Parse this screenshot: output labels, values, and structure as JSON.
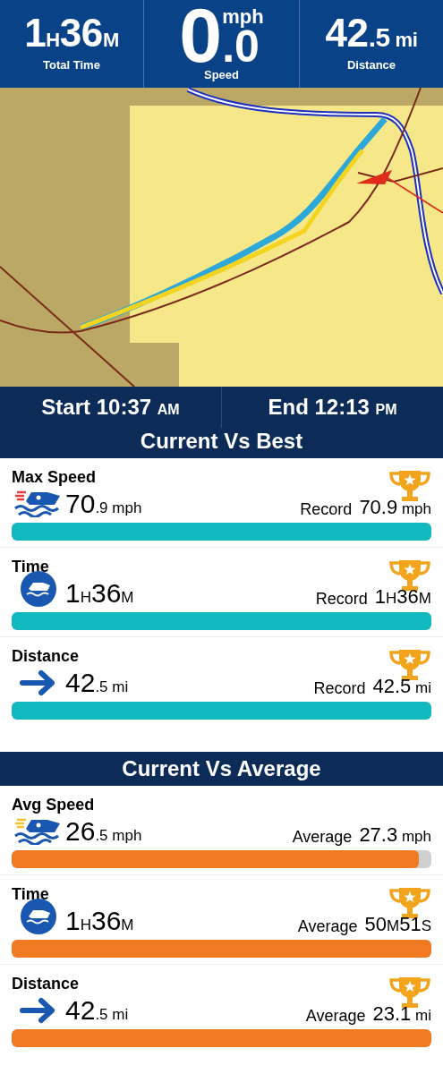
{
  "header_stats": [
    {
      "kind": "inline",
      "parts": [
        {
          "text": "1",
          "kind": "major"
        },
        {
          "text": "H",
          "kind": "minor"
        },
        {
          "text": "36",
          "kind": "major"
        },
        {
          "text": "M",
          "kind": "minor"
        }
      ],
      "label": "Total Time"
    },
    {
      "kind": "stacked",
      "whole": "0",
      "unit": "mph",
      "fraction": ".0",
      "label": "Speed"
    },
    {
      "kind": "inline",
      "parts": [
        {
          "text": "42",
          "kind": "major"
        },
        {
          "text": ".5",
          "kind": "mid"
        },
        {
          "text": " mi",
          "kind": "minor"
        }
      ],
      "label": "Distance"
    }
  ],
  "trip_times": [
    {
      "label": "Start",
      "time": "10:37",
      "period": "AM"
    },
    {
      "label": "End",
      "time": "12:13",
      "period": "PM"
    }
  ],
  "sections": [
    {
      "title": "Current Vs Best",
      "kind": "best",
      "rows": [
        {
          "label": "Max Speed",
          "kind": "speed",
          "value": [
            {
              "text": "70",
              "kind": "major"
            },
            {
              "text": ".9 mph",
              "kind": "minor"
            }
          ],
          "compare_label": "Record",
          "compare": [
            {
              "text": "70.9",
              "kind": "mid"
            },
            {
              "text": " mph",
              "kind": "minor"
            }
          ],
          "trophy": true,
          "level": 1
        },
        {
          "label": "Time",
          "kind": "time",
          "value": [
            {
              "text": "1",
              "kind": "major"
            },
            {
              "text": "H",
              "kind": "minor"
            },
            {
              "text": "36",
              "kind": "major"
            },
            {
              "text": "M",
              "kind": "minor"
            }
          ],
          "compare_label": "Record",
          "compare": [
            {
              "text": "1",
              "kind": "mid"
            },
            {
              "text": "H",
              "kind": "minor"
            },
            {
              "text": "36",
              "kind": "mid"
            },
            {
              "text": "M",
              "kind": "minor"
            }
          ],
          "trophy": true,
          "level": 1
        },
        {
          "label": "Distance",
          "kind": "distance",
          "value": [
            {
              "text": "42",
              "kind": "major"
            },
            {
              "text": ".5 mi",
              "kind": "minor"
            }
          ],
          "compare_label": "Record",
          "compare": [
            {
              "text": "42.5",
              "kind": "mid"
            },
            {
              "text": " mi",
              "kind": "minor"
            }
          ],
          "trophy": true,
          "level": 1
        }
      ]
    },
    {
      "title": "Current Vs Average",
      "kind": "average",
      "rows": [
        {
          "label": "Avg Speed",
          "kind": "speed",
          "value": [
            {
              "text": "26",
              "kind": "major"
            },
            {
              "text": ".5 mph",
              "kind": "minor"
            }
          ],
          "compare_label": "Average",
          "compare": [
            {
              "text": "27.3",
              "kind": "mid"
            },
            {
              "text": " mph",
              "kind": "minor"
            }
          ],
          "trophy": false,
          "level": 0.97
        },
        {
          "label": "Time",
          "kind": "time",
          "value": [
            {
              "text": "1",
              "kind": "major"
            },
            {
              "text": "H",
              "kind": "minor"
            },
            {
              "text": "36",
              "kind": "major"
            },
            {
              "text": "M",
              "kind": "minor"
            }
          ],
          "compare_label": "Average",
          "compare": [
            {
              "text": "50",
              "kind": "mid"
            },
            {
              "text": "M",
              "kind": "minor"
            },
            {
              "text": "51",
              "kind": "mid"
            },
            {
              "text": "S",
              "kind": "minor"
            }
          ],
          "trophy": true,
          "level": 1
        },
        {
          "label": "Distance",
          "kind": "distance",
          "value": [
            {
              "text": "42",
              "kind": "major"
            },
            {
              "text": ".5 mi",
              "kind": "minor"
            }
          ],
          "compare_label": "Average",
          "compare": [
            {
              "text": "23.1",
              "kind": "mid"
            },
            {
              "text": " mi",
              "kind": "minor"
            }
          ],
          "trophy": true,
          "level": 1
        }
      ]
    }
  ]
}
